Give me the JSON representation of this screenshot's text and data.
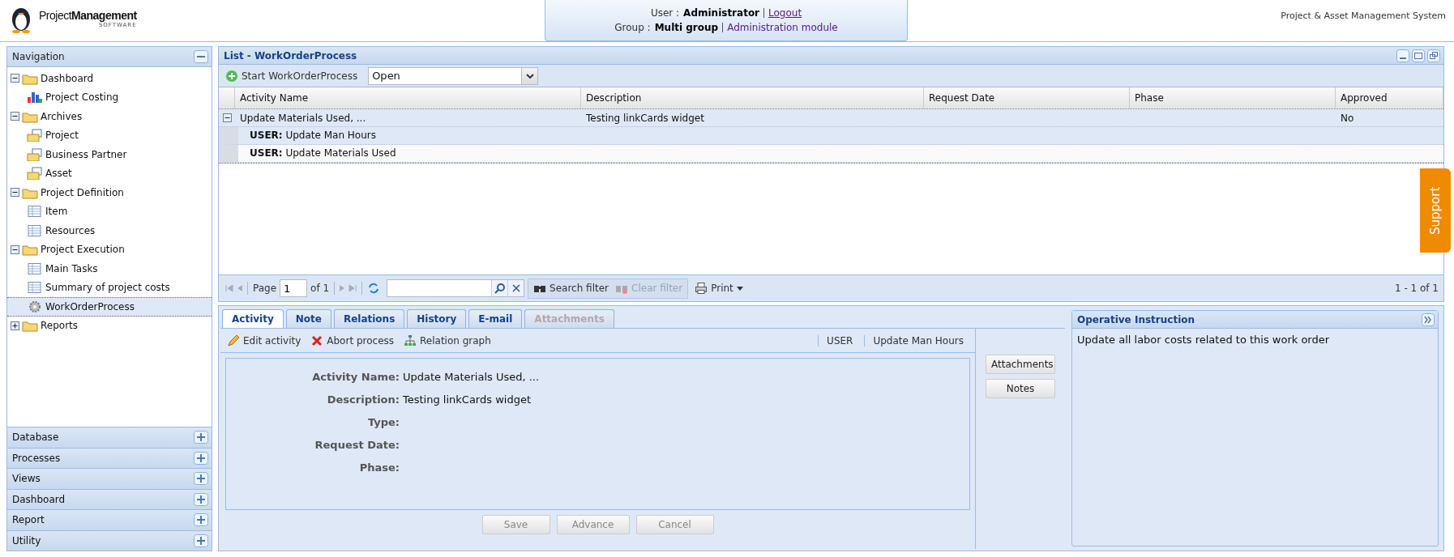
{
  "header": {
    "logo_text": "Project**Management**",
    "logo_subtitle": "SOFTWARE",
    "user_label": "User :",
    "user_name": "Administrator",
    "logout": "Logout",
    "group_label": "Group :",
    "group_name": "Multi group",
    "module_link": "Administration module",
    "app_name": "Project & Asset Management System"
  },
  "sidebar": {
    "title": "Navigation",
    "expanded": true,
    "tree": [
      {
        "label": "Dashboard",
        "kind": "folder",
        "expanded": true,
        "children": [
          {
            "label": "Project Costing",
            "kind": "chart",
            "selected": false
          }
        ]
      },
      {
        "label": "Archives",
        "kind": "folder",
        "expanded": true,
        "children": [
          {
            "label": "Project",
            "kind": "archive",
            "selected": false
          },
          {
            "label": "Business Partner",
            "kind": "archive",
            "selected": false
          },
          {
            "label": "Asset",
            "kind": "archive",
            "selected": false
          }
        ]
      },
      {
        "label": "Project Definition",
        "kind": "folder",
        "expanded": true,
        "children": [
          {
            "label": "Item",
            "kind": "table",
            "selected": false
          },
          {
            "label": "Resources",
            "kind": "table",
            "selected": false
          }
        ]
      },
      {
        "label": "Project Execution",
        "kind": "folder",
        "expanded": true,
        "children": [
          {
            "label": "Main Tasks",
            "kind": "table",
            "selected": false
          },
          {
            "label": "Summary of project costs",
            "kind": "table",
            "selected": false
          },
          {
            "label": "WorkOrderProcess",
            "kind": "gear",
            "selected": true
          }
        ]
      },
      {
        "label": "Reports",
        "kind": "folder",
        "expanded": false
      }
    ],
    "sections": [
      {
        "title": "Database",
        "expanded": false
      },
      {
        "title": "Processes",
        "expanded": false
      },
      {
        "title": "Views",
        "expanded": false
      },
      {
        "title": "Dashboard",
        "expanded": false
      },
      {
        "title": "Report",
        "expanded": false
      },
      {
        "title": "Utility",
        "expanded": false
      }
    ]
  },
  "list": {
    "title": "List - WorkOrderProcess",
    "start_button": "Start WorkOrderProcess",
    "filter_value": "Open",
    "columns": [
      "Activity Name",
      "Description",
      "Request Date",
      "Phase",
      "Approved"
    ],
    "rows": [
      {
        "cells": [
          "Update Materials Used, ...",
          "Testing linkCards widget",
          "",
          "",
          "No"
        ],
        "expanded": true,
        "selected": true,
        "children": [
          {
            "text": "**USER:** Update Man Hours",
            "selected": true
          },
          {
            "text": "**USER:** Update Materials Used",
            "selected": false
          }
        ]
      }
    ],
    "paging": {
      "page_label": "Page",
      "page": "1",
      "of_label": "of 1",
      "search_filter": "Search filter",
      "clear_filter": "Clear filter",
      "clear_filter_disabled": true,
      "print": "Print",
      "count": "1 - 1 of 1"
    }
  },
  "detail": {
    "tabs": [
      {
        "label": "Activity",
        "selected": true,
        "disabled": false
      },
      {
        "label": "Note",
        "selected": false,
        "disabled": false
      },
      {
        "label": "Relations",
        "selected": false,
        "disabled": false
      },
      {
        "label": "History",
        "selected": false,
        "disabled": false
      },
      {
        "label": "E-mail",
        "selected": false,
        "disabled": false
      },
      {
        "label": "Attachments",
        "selected": false,
        "disabled": true
      }
    ],
    "actions": [
      {
        "label": "Edit activity",
        "kind": "edit"
      },
      {
        "label": "Abort process",
        "kind": "abort"
      },
      {
        "label": "Relation graph",
        "kind": "graph"
      }
    ],
    "info": [
      "USER",
      "Update Man Hours"
    ],
    "fields": [
      {
        "label": "Activity Name:",
        "value": "Update Materials Used, ..."
      },
      {
        "label": "Description:",
        "value": "Testing linkCards widget"
      },
      {
        "label": "Type:"
      },
      {
        "label": "Request Date:"
      },
      {
        "label": "Phase:"
      }
    ],
    "side_buttons": [
      "Attachments",
      "Notes"
    ],
    "buttons": [
      {
        "label": "Save",
        "disabled": true
      },
      {
        "label": "Advance",
        "disabled": true
      },
      {
        "label": "Cancel",
        "disabled": true
      }
    ]
  },
  "instruction": {
    "title": "Operative Instruction",
    "text": "Update all labor costs related to this work order"
  },
  "support": "Support"
}
